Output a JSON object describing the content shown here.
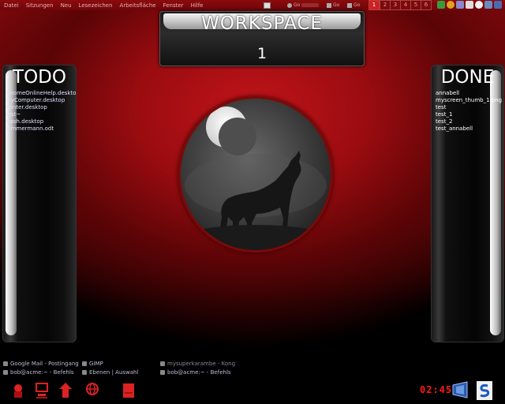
{
  "menubar": {
    "items": [
      "Datei",
      "Sitzungen",
      "Neu",
      "Lesezeichen",
      "Arbeitsfläche",
      "Fenster",
      "Hilfe"
    ],
    "tasks": [
      "Go",
      "Go",
      "Go"
    ],
    "workspaces": [
      "1",
      "2",
      "3",
      "4",
      "5",
      "6"
    ],
    "active_workspace": "1"
  },
  "workspace": {
    "title": "WORKSPACE",
    "number": "1"
  },
  "todo": {
    "title": "TODO",
    "files": [
      "GnomeOnlineHelp.desktop",
      "myComputer.desktop",
      "Printer.desktop",
      "test~",
      "trash.desktop",
      "Zimmermann.odt"
    ]
  },
  "done": {
    "title": "DONE",
    "files": [
      "annabell",
      "myscreen_thumb_1.png",
      "test",
      "test_1",
      "test_2",
      "test_annabell"
    ]
  },
  "taskbar": {
    "row1": [
      "Google Mail - Postingang",
      "GIMP",
      "mysuperkarambe - Kong"
    ],
    "row2": [
      "bob@acme:~ - Befehls",
      "Ebenen | Auswahl",
      "bob@acme:~ - Befehls"
    ]
  },
  "clock": "02:45",
  "colors": {
    "background": "#8e0b0f",
    "accent_red": "#d02020",
    "clock": "#ff1a1a"
  }
}
